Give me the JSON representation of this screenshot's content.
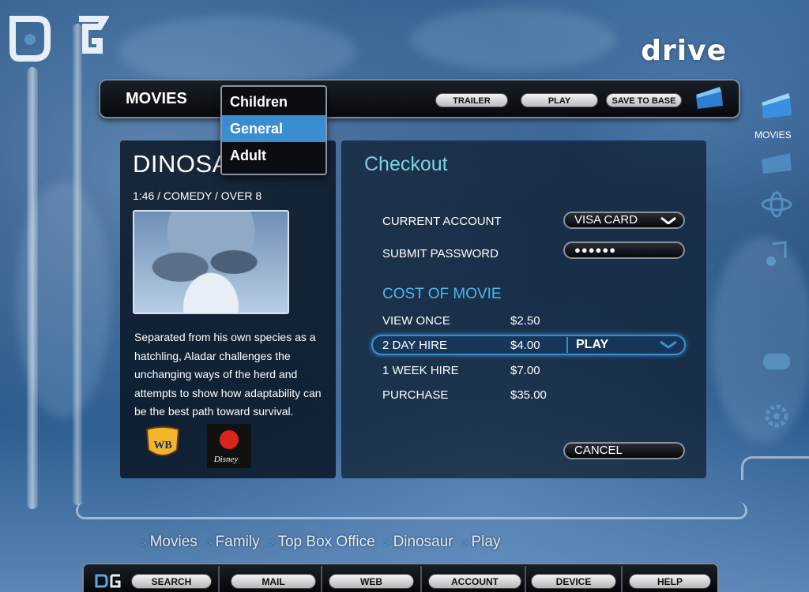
{
  "brand": "drive",
  "topbar": {
    "title": "MOVIES",
    "buttons": [
      "TRAILER",
      "PLAY",
      "SAVE TO BASE"
    ]
  },
  "menu": {
    "items": [
      "Children",
      "General",
      "Adult"
    ],
    "selected": "General"
  },
  "movie": {
    "title": "DINOSAUR",
    "visible_title": "DINOSA",
    "meta": "1:46 / COMEDY / OVER 8",
    "description": "Separated from his own species as a hatchling, Aladar challenges the unchanging ways of the herd and attempts to show how adaptability can be the best path toward survival."
  },
  "checkout": {
    "title": "Checkout",
    "current_account_label": "CURRENT ACCOUNT",
    "current_account_value": "VISA CARD",
    "password_label": "SUBMIT PASSWORD",
    "password_value": "●●●●●●",
    "cost_heading": "COST OF MOVIE",
    "options": [
      {
        "name": "VIEW ONCE",
        "price": "$2.50"
      },
      {
        "name": "2 DAY HIRE",
        "price": "$4.00"
      },
      {
        "name": "1 WEEK HIRE",
        "price": "$7.00"
      },
      {
        "name": "PURCHASE",
        "price": "$35.00"
      }
    ],
    "selected_action": "PLAY",
    "cancel_label": "CANCEL"
  },
  "sidebar": {
    "active_label": "MOVIES"
  },
  "breadcrumb": [
    "Movies",
    "Family",
    "Top Box Office",
    "Dinosaur",
    "Play"
  ],
  "bottom_nav": [
    "SEARCH",
    "MAIL",
    "WEB",
    "ACCOUNT",
    "DEVICE",
    "HELP"
  ],
  "colors": {
    "accent": "#3a8ed0",
    "checkout_title": "#7ed0e8",
    "section_head": "#4cb8ec"
  }
}
